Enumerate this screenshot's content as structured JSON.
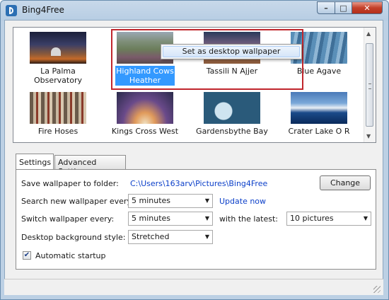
{
  "window": {
    "title": "Bing4Free"
  },
  "gallery": {
    "items": [
      {
        "caption": "La Palma Observatory",
        "image": "night-sky-observatory"
      },
      {
        "caption": "Highland Cows Heather",
        "image": "highland-landscape",
        "selected": true
      },
      {
        "caption": "Tassili N Ajjer",
        "image": "desert-rock-arch"
      },
      {
        "caption": "Blue Agave",
        "image": "blue-agave-plant"
      },
      {
        "caption": "Fire Hoses",
        "image": "fire-hoses-tower"
      },
      {
        "caption": "Kings Cross West",
        "image": "station-roof-structure"
      },
      {
        "caption": "Gardensbythe Bay",
        "image": "garden-domes-aerial"
      },
      {
        "caption": "Crater Lake O R",
        "image": "crater-lake-winter"
      }
    ]
  },
  "context_menu": {
    "item": "Set as desktop wallpaper"
  },
  "tabs": [
    "Settings",
    "Advanced Settings"
  ],
  "settings": {
    "save_label": "Save wallpaper to folder:",
    "save_path": "C:\\Users\\163arv\\Pictures\\Bing4Free",
    "change_button": "Change",
    "search_label": "Search new wallpaper every:",
    "search_value": "5 minutes",
    "update_now": "Update now",
    "switch_label": "Switch wallpaper every:",
    "switch_value": "5 minutes",
    "latest_label": "with the latest:",
    "latest_value": "10 pictures",
    "style_label": "Desktop background style:",
    "style_value": "Stretched",
    "startup_label": "Automatic startup",
    "startup_checked": true
  },
  "colors": {
    "selection": "#3399ff",
    "highlight_box": "#c0262c",
    "link": "#0b3fc9"
  }
}
